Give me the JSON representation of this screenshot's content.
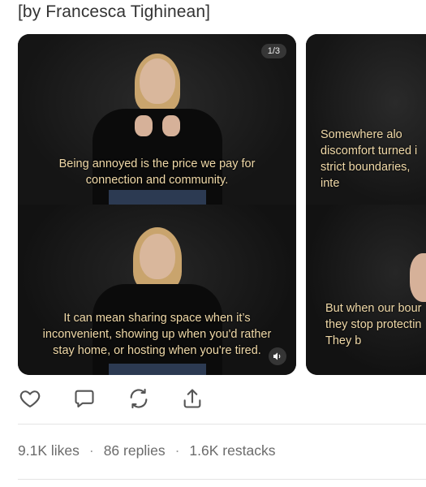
{
  "byline": "[by Francesca Tighinean]",
  "carousel": {
    "counter": "1/3",
    "card1": {
      "caption_top": "Being annoyed is the price we pay for\nconnection and community.",
      "caption_bottom": "It can mean sharing space when it’s\ninconvenient, showing up when you'd rather\nstay home, or hosting when you're tired."
    },
    "card2": {
      "caption_top": "Somewhere alo\ndiscomfort turned i\nstrict boundaries,\ninte",
      "caption_bottom": "But when our bour\nthey stop protectin\nThey b"
    }
  },
  "actions": [
    "heart-icon",
    "comment-icon",
    "repost-icon",
    "share-icon"
  ],
  "stats": {
    "likes": "9.1K likes",
    "replies": "86 replies",
    "restacks": "1.6K restacks",
    "separator": "·"
  },
  "colors": {
    "caption": "#f0d9a8",
    "card_bg": "#141414",
    "stats_text": "#6b6b6b"
  }
}
